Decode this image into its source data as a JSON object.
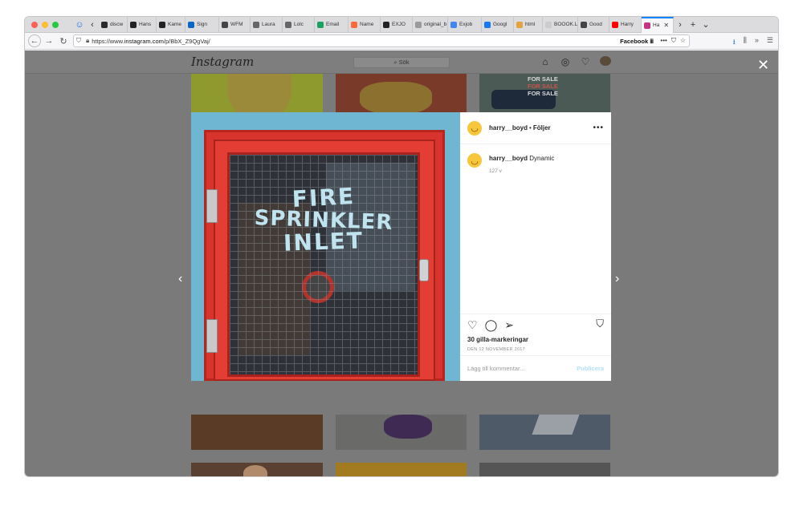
{
  "browser": {
    "tabs": [
      {
        "label": "discw",
        "color": "#2a2a2a"
      },
      {
        "label": "Hans",
        "color": "#222222"
      },
      {
        "label": "Kame",
        "color": "#222222"
      },
      {
        "label": "Sign",
        "color": "#0a66c2"
      },
      {
        "label": "WFM",
        "color": "#444444"
      },
      {
        "label": "Laura",
        "color": "#666666"
      },
      {
        "label": "Lolc",
        "color": "#666666"
      },
      {
        "label": "Email",
        "color": "#1aa260"
      },
      {
        "label": "Name",
        "color": "#ff6a3d"
      },
      {
        "label": "EXJO",
        "color": "#222222"
      },
      {
        "label": "original_b",
        "color": "#9a9a9a"
      },
      {
        "label": "Exjob",
        "color": "#4285f4"
      },
      {
        "label": "Googl",
        "color": "#1877f2"
      },
      {
        "label": "html",
        "color": "#e6a23c"
      },
      {
        "label": "BOOOK.L",
        "color": "#cccccc"
      },
      {
        "label": "Good",
        "color": "#444444"
      },
      {
        "label": "Harry",
        "color": "#ff0000"
      },
      {
        "label": "Ha",
        "color": "#c13584",
        "active": true
      }
    ],
    "url_prefix": "https://www.",
    "url_domain": "instagram.com",
    "url_path": "/p/BbX_Z9QgVaj/",
    "bookmark_label": "Facebook"
  },
  "instagram": {
    "logo": "Instagram",
    "search_placeholder": "Sök",
    "post": {
      "username": "harry__boyd",
      "separator": "•",
      "follow_label": "Följer",
      "caption_user": "harry__boyd",
      "caption_text": "Dynamic",
      "age": "127 v",
      "likes": "30 gilla-markeringar",
      "date": "DEN 12 NOVEMBER 2017",
      "comment_placeholder": "Lägg till kommentar...",
      "publish_label": "Publicera",
      "photo_text": [
        "FIRE",
        "SPRINKLER",
        "INLET"
      ]
    },
    "grid_text": [
      "FOR SALE",
      "FOR SALE",
      "FOR SALE"
    ]
  },
  "colors": {
    "overlay": "#7a7a7a",
    "link_disabled": "#b2dffc",
    "active_tab_accent": "#0a84ff"
  }
}
